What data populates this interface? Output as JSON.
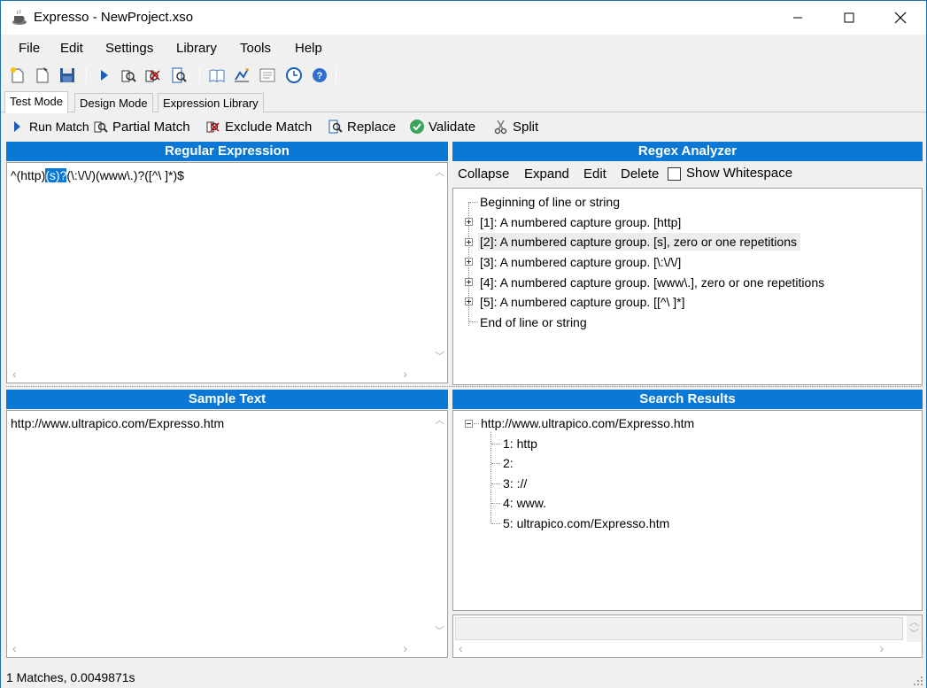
{
  "window": {
    "title": "Expresso - NewProject.xso"
  },
  "menu": [
    "File",
    "Edit",
    "Settings",
    "Library",
    "Tools",
    "Help"
  ],
  "toolbar_icons": [
    "new-file-icon",
    "open-file-icon",
    "save-icon",
    "run-icon",
    "partial-match-icon",
    "exclude-match-icon",
    "replace-icon",
    "library-icon",
    "chart-icon",
    "notes-icon",
    "clock-icon",
    "help-icon"
  ],
  "tabs": [
    "Test Mode",
    "Design Mode",
    "Expression Library"
  ],
  "actions": {
    "run_match": "Run Match",
    "partial_match": "Partial Match",
    "exclude_match": "Exclude Match",
    "replace": "Replace",
    "validate": "Validate",
    "split": "Split"
  },
  "regex_panel": {
    "header": "Regular Expression",
    "expr_before": "^(http)",
    "expr_selected": "(s)?",
    "expr_after": "(\\:\\/\\/)(www\\.)?([^\\ ]*)$"
  },
  "analyzer": {
    "header": "Regex Analyzer",
    "buttons": [
      "Collapse",
      "Expand",
      "Edit",
      "Delete"
    ],
    "show_whitespace": "Show Whitespace",
    "items": [
      "Beginning of line or string",
      "[1]: A numbered capture group. [http]",
      "[2]: A numbered capture group. [s], zero or one repetitions",
      "[3]: A numbered capture group. [\\:\\/\\/]",
      "[4]: A numbered capture group. [www\\.], zero or one repetitions",
      "[5]: A numbered capture group. [[^\\ ]*]",
      "End of line or string"
    ]
  },
  "sample_panel": {
    "header": "Sample Text",
    "text": "http://www.ultrapico.com/Expresso.htm"
  },
  "results_panel": {
    "header": "Search Results",
    "root": "http://www.ultrapico.com/Expresso.htm",
    "groups": [
      "1: http",
      "2:",
      "3: ://",
      "4: www.",
      "5: ultrapico.com/Expresso.htm"
    ]
  },
  "status": {
    "text": "1 Matches, 0.0049871s"
  },
  "colors": {
    "header_blue": "#0a78d4",
    "selection": "#0a78d4"
  }
}
